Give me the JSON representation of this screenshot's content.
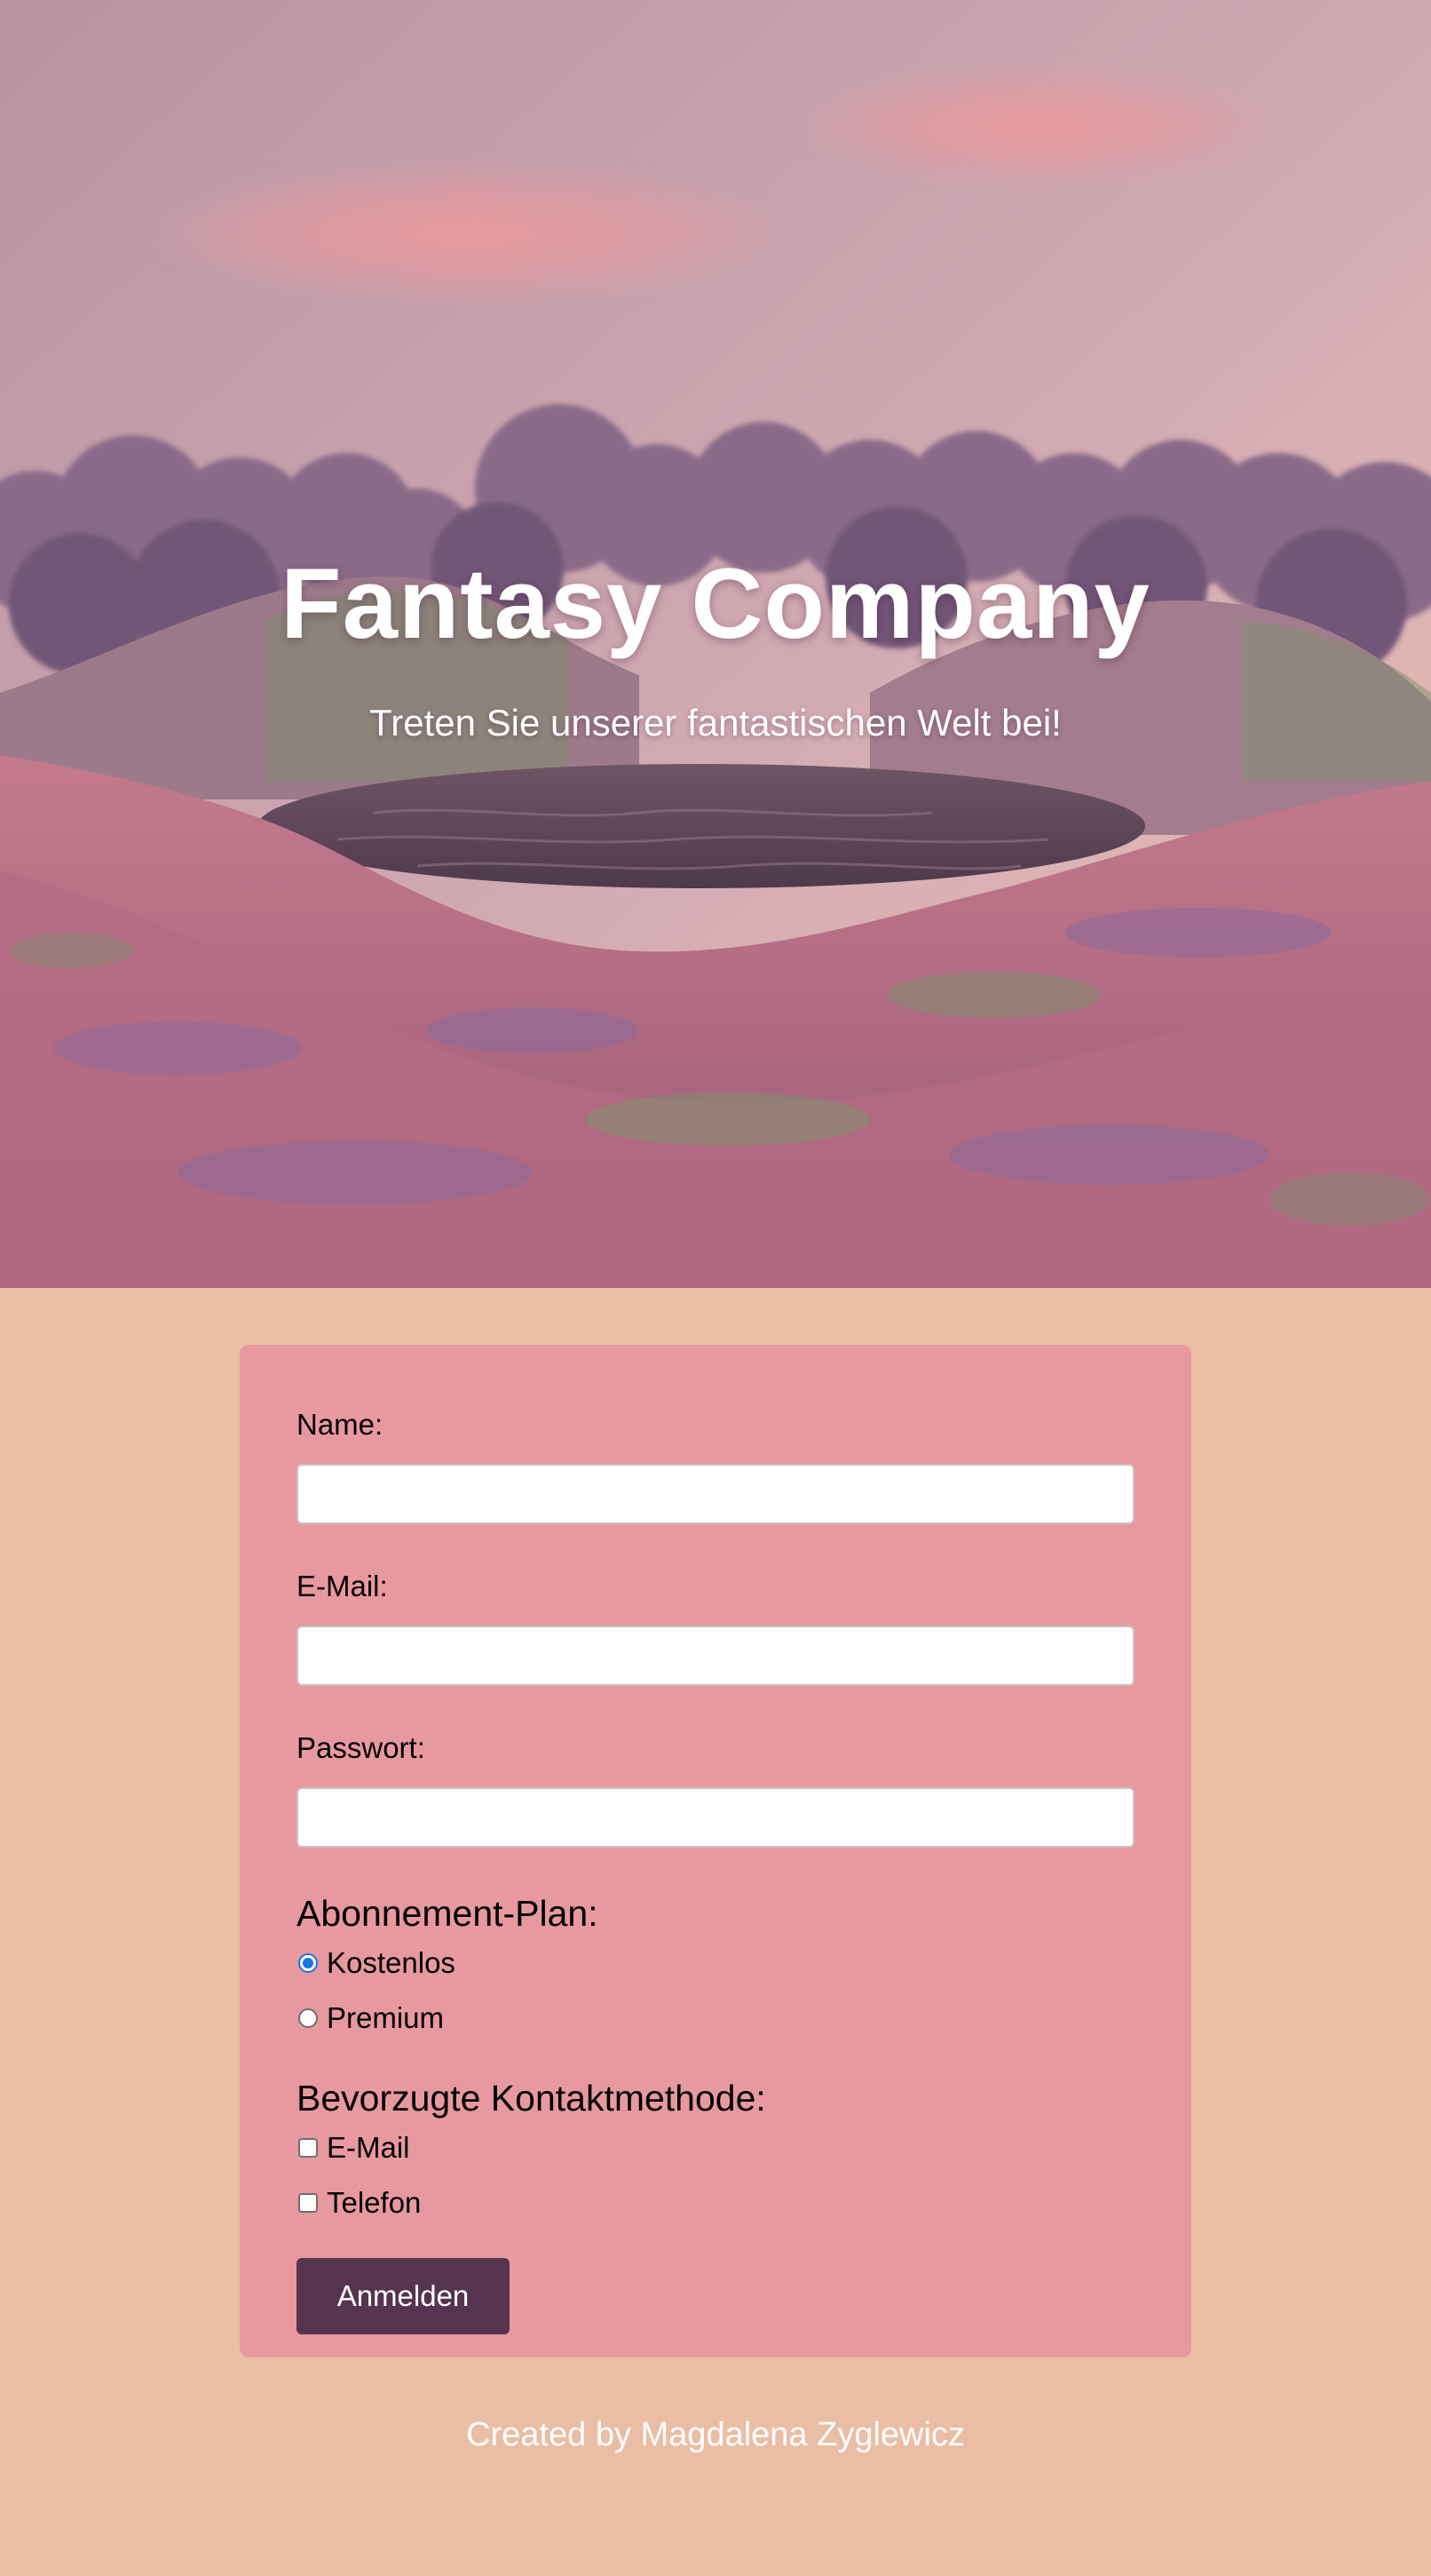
{
  "hero": {
    "title": "Fantasy Company",
    "subtitle": "Treten Sie unserer fantastischen Welt bei!",
    "background_image": "fantasy-landscape-image"
  },
  "form": {
    "name_label": "Name:",
    "email_label": "E-Mail:",
    "password_label": "Passwort:",
    "name_value": "",
    "email_value": "",
    "password_value": "",
    "plan_heading": "Abonnement-Plan:",
    "plan_options": [
      {
        "label": "Kostenlos",
        "checked": true
      },
      {
        "label": "Premium",
        "checked": false
      }
    ],
    "contact_heading": "Bevorzugte Kontaktmethode:",
    "contact_options": [
      {
        "label": "E-Mail",
        "checked": false
      },
      {
        "label": "Telefon",
        "checked": false
      }
    ],
    "submit_label": "Anmelden"
  },
  "footer": {
    "text": "Created by Magdalena Zyglewicz"
  },
  "colors": {
    "page_background": "#e9bea5",
    "form_background": "#e899a0",
    "button_background": "#56344f",
    "radio_accent": "#1a73e8"
  }
}
